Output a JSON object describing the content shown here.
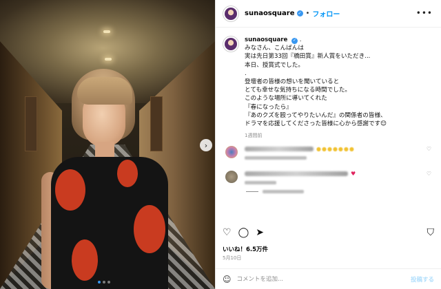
{
  "post": {
    "username": "sunaosquare",
    "follow_label": "フォロー",
    "dot_separator": "•",
    "more_icon": "more-horizontal-icon",
    "caption_user": "sunaosquare",
    "caption_suffix": ".",
    "caption_lines": [
      "みなさん、こんばんは",
      "実は先日第33回『橋田賞』新人賞をいただき...",
      "本日、授賞式でした。",
      ".",
      "登壇者の皆様の想いを聞いていると",
      "とても幸せな気持ちになる時間でした。",
      "このような場所に導いてくれた",
      "『春になったら』",
      "『あのクズを殴ってやりたいんだ』の関係者の皆様、",
      "ドラマを応援してくださった皆様に心から感謝です😊"
    ],
    "time_ago": "1週間前",
    "likes": "いいね！6.5万件",
    "date": "5月10日",
    "comment_placeholder": "コメントを追加...",
    "post_button": "投稿する"
  },
  "icons": {
    "like": "heart-icon",
    "comment": "comment-icon",
    "share": "share-icon",
    "save": "bookmark-icon",
    "emoji": "emoji-icon",
    "next": "chevron-right-icon"
  },
  "colors": {
    "accent": "#0095f6",
    "verified": "#3897f0",
    "muted": "#8e8e8e"
  }
}
